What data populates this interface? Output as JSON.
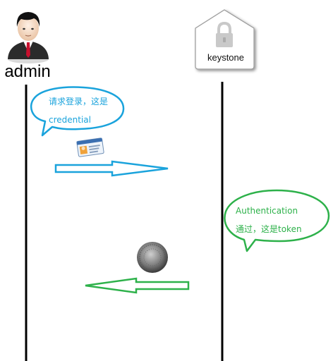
{
  "actors": {
    "admin": {
      "label": "admin"
    },
    "keystone": {
      "label": "keystone"
    }
  },
  "messages": {
    "request": {
      "line1": "请求登录，这是",
      "line2": "credential",
      "color": "#1aa3dc"
    },
    "response": {
      "line1": "Authentication",
      "line2": "通过，这是token",
      "color": "#2db14a"
    }
  },
  "icons": {
    "admin_avatar": "user-avatar-icon",
    "keystone_logo": "lock-icon",
    "credential": "id-card-icon",
    "token": "coin-icon"
  }
}
